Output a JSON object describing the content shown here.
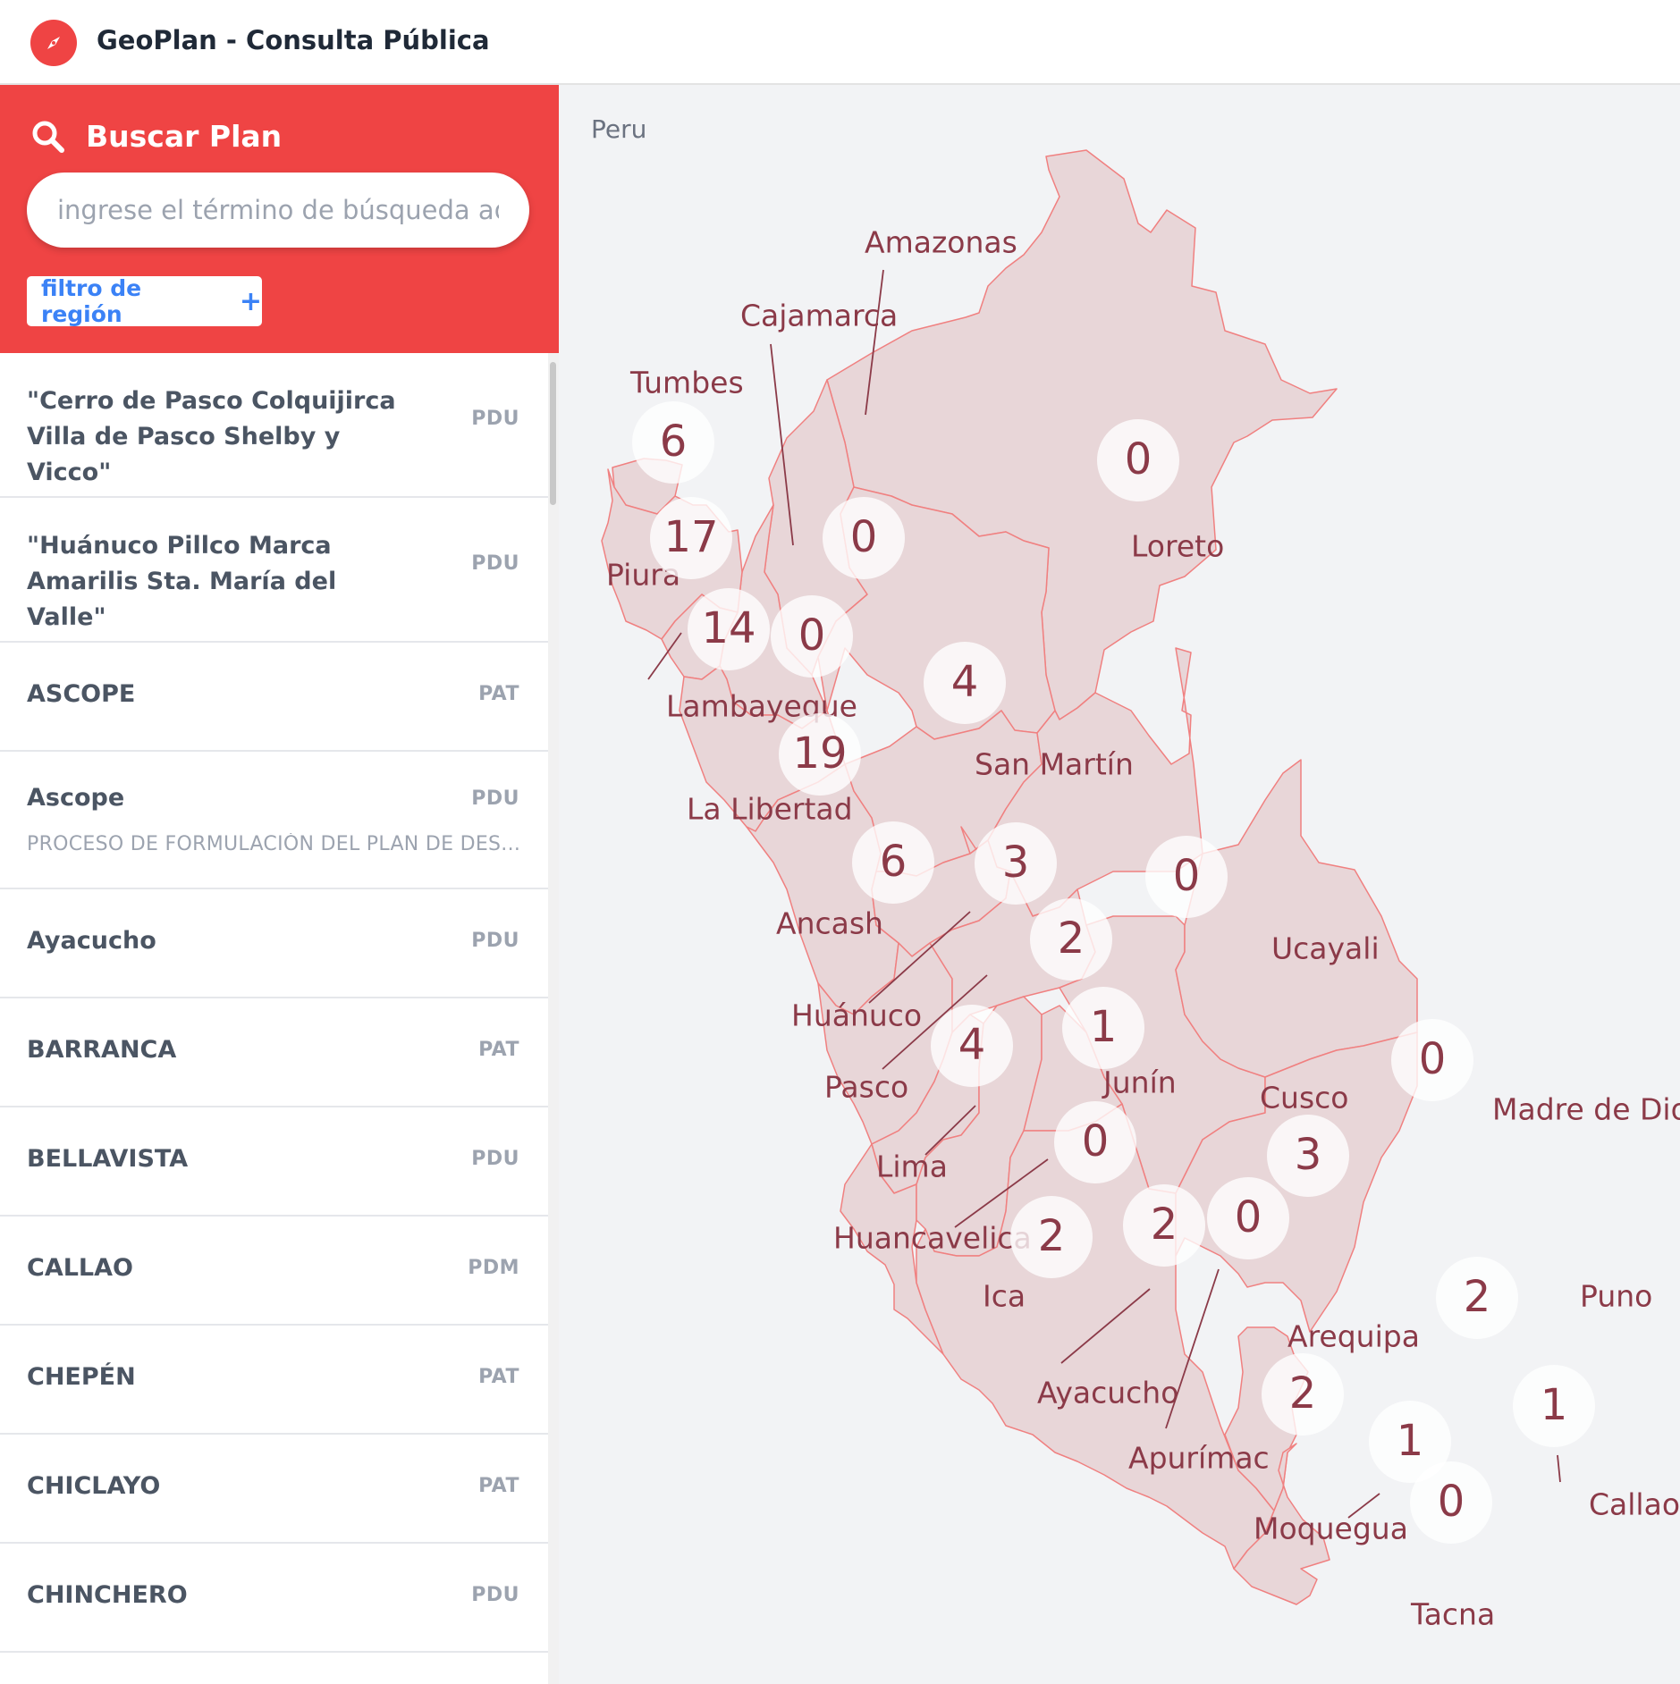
{
  "app": {
    "title": "GeoPlan - Consulta Pública",
    "logo_icon": "compass-icon",
    "accent_color": "#ef4444"
  },
  "search": {
    "title": "Buscar Plan",
    "placeholder": "ingrese el término de búsqueda aquí",
    "filter_label": "filtro de región",
    "filter_plus": "+"
  },
  "plans": [
    {
      "name": "\"Cerro de Pasco Colquijirca Villa de Pasco Shelby y Vicco\"",
      "type": "PDU",
      "desc": ""
    },
    {
      "name": "\"Huánuco Pillco Marca Amarilis Sta. María del Valle\"",
      "type": "PDU",
      "desc": ""
    },
    {
      "name": "ASCOPE",
      "type": "PAT",
      "desc": ""
    },
    {
      "name": "Ascope",
      "type": "PDU",
      "desc": "PROCESO DE FORMULACIÓN DEL PLAN DE DES..."
    },
    {
      "name": "Ayacucho",
      "type": "PDU",
      "desc": ""
    },
    {
      "name": "BARRANCA",
      "type": "PAT",
      "desc": ""
    },
    {
      "name": "BELLAVISTA",
      "type": "PDU",
      "desc": ""
    },
    {
      "name": "CALLAO",
      "type": "PDM",
      "desc": ""
    },
    {
      "name": "CHEPÉN",
      "type": "PAT",
      "desc": ""
    },
    {
      "name": "CHICLAYO",
      "type": "PAT",
      "desc": ""
    },
    {
      "name": "CHINCHERO",
      "type": "PDU",
      "desc": ""
    }
  ],
  "map": {
    "country": "Peru",
    "fill_color": "#e8d6d8",
    "stroke_color": "#f08080",
    "label_color": "#8b3a48",
    "regions": [
      {
        "name": "Tumbes",
        "count": "6"
      },
      {
        "name": "Piura",
        "count": "17"
      },
      {
        "name": "Lambayeque",
        "count": "14"
      },
      {
        "name": "Cajamarca",
        "count": "0"
      },
      {
        "name": "Amazonas",
        "count": "0"
      },
      {
        "name": "Loreto",
        "count": "0"
      },
      {
        "name": "San Martín",
        "count": "4"
      },
      {
        "name": "La Libertad",
        "count": "19"
      },
      {
        "name": "Ancash",
        "count": "6"
      },
      {
        "name": "Huánuco",
        "count": "3"
      },
      {
        "name": "Pasco",
        "count": "2"
      },
      {
        "name": "Ucayali",
        "count": "0"
      },
      {
        "name": "Lima",
        "count": "4"
      },
      {
        "name": "Junín",
        "count": "1"
      },
      {
        "name": "Huancavelica",
        "count": "0"
      },
      {
        "name": "Cusco",
        "count": "3"
      },
      {
        "name": "Madre de Dios",
        "count": "0"
      },
      {
        "name": "Ica",
        "count": "2"
      },
      {
        "name": "Ayacucho",
        "count": "2"
      },
      {
        "name": "Apurímac",
        "count": "0"
      },
      {
        "name": "Arequipa",
        "count": "2"
      },
      {
        "name": "Puno",
        "count": "2"
      },
      {
        "name": "Moquegua",
        "count": "1"
      },
      {
        "name": "Tacna",
        "count": "0"
      },
      {
        "name": "Callao",
        "count": "1"
      }
    ]
  }
}
